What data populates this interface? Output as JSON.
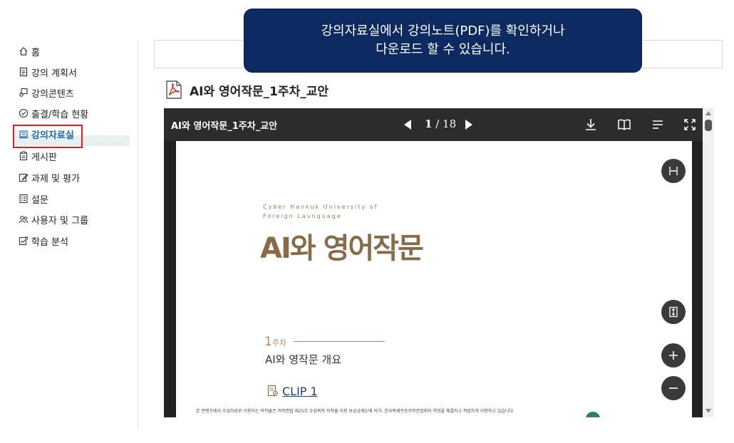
{
  "tooltip": {
    "line1": "강의자료실에서 강의노트(PDF)를 확인하거나",
    "line2": "다운로드 할 수 있습니다."
  },
  "sidebar": {
    "items": [
      {
        "label": "홈",
        "icon": "home-icon"
      },
      {
        "label": "강의 계획서",
        "icon": "document-icon"
      },
      {
        "label": "강의콘텐츠",
        "icon": "content-icon"
      },
      {
        "label": "출결/학습 현황",
        "icon": "check-circle-icon"
      },
      {
        "label": "강의자료실",
        "icon": "archive-icon",
        "active": true
      },
      {
        "label": "게시판",
        "icon": "board-icon"
      },
      {
        "label": "과제 및 평가",
        "icon": "edit-icon"
      },
      {
        "label": "설문",
        "icon": "survey-icon"
      },
      {
        "label": "사용자 및 그룹",
        "icon": "users-icon"
      },
      {
        "label": "학습 분석",
        "icon": "analytics-icon"
      }
    ]
  },
  "document": {
    "title": "AI와 영어작문_1주차_교안"
  },
  "viewer": {
    "toolbar_title": "AI와 영어작문_1주차_교안",
    "current_page": "1",
    "page_sep": " / ",
    "total_pages": "18"
  },
  "page": {
    "uni_line1": "Cyber Hankuk University of",
    "uni_line2": "Foreign Launguage",
    "big_title": "AI와 영어작문",
    "week_num": "1",
    "week_suffix": "주차",
    "subtitle": "AI와 영작문 개요",
    "clip": "CLIP 1",
    "footer_note": "본 콘텐츠에서 수업자료로 이용되는 저작물은 저작권법 제25조 수업목적 저작물 이용 보상금제도에 의거, 한국복제전송저작권협회와 약정을 체결하고 적법하게 이용하고 있습니다."
  },
  "colors": {
    "tooltip_bg": "#0c2a60",
    "active_text": "#1e66b4",
    "highlight": "#e02020",
    "title_brown": "#8a6a48"
  }
}
